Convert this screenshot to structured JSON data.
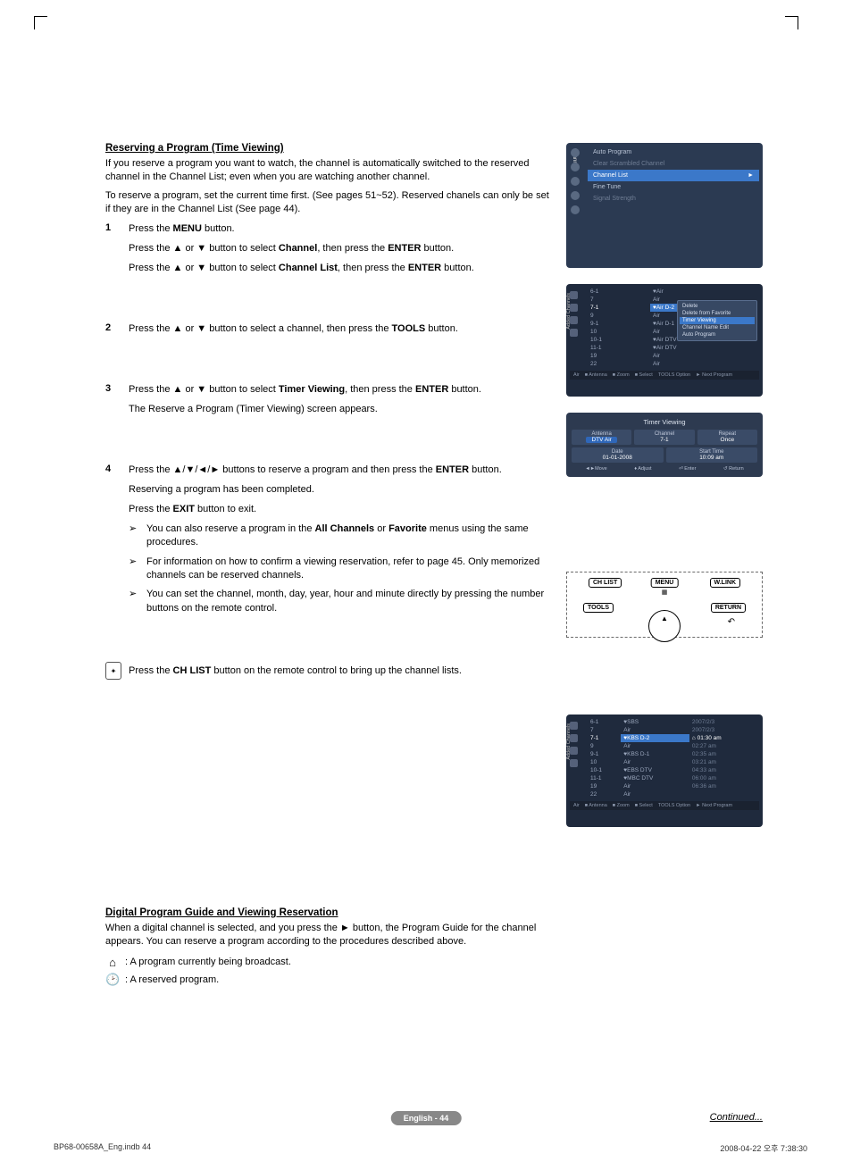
{
  "section1": {
    "title": "Reserving a Program (Time Viewing)",
    "intro1": "If you reserve a program you want to watch, the channel is automatically switched to the reserved channel in the Channel List; even when you are watching another channel.",
    "intro2": "To reserve a program, set the current time first. (See pages 51~52). Reserved chanels can only be set if they are in the Channel List (See page 44).",
    "steps": [
      {
        "n": "1",
        "lines": [
          {
            "pre": "Press the ",
            "b": "MENU",
            "post": " button."
          },
          {
            "pre": "Press the ▲ or ▼ button to select ",
            "b": "Channel",
            "post": ", then press the ",
            "b2": "ENTER",
            "post2": " button."
          },
          {
            "pre": "Press the ▲ or ▼ button to select ",
            "b": "Channel List",
            "post": ", then press the ",
            "b2": "ENTER",
            "post2": " button."
          }
        ]
      },
      {
        "n": "2",
        "lines": [
          {
            "pre": "Press the ▲ or ▼ button to select a channel, then press the ",
            "b": "TOOLS",
            "post": " button."
          }
        ]
      },
      {
        "n": "3",
        "lines": [
          {
            "pre": "Press the ▲ or ▼ button to select ",
            "b": "Timer Viewing",
            "post": ", then press the ",
            "b2": "ENTER",
            "post2": " button."
          },
          {
            "plain": "The Reserve a Program (Timer Viewing) screen appears."
          }
        ]
      },
      {
        "n": "4",
        "lines": [
          {
            "pre": "Press the ▲/▼/◄/► buttons to reserve a program and then press the ",
            "b": "ENTER",
            "post": " button."
          },
          {
            "plain": "Reserving a program has been completed."
          },
          {
            "pre": "Press the ",
            "b": "EXIT",
            "post": " button to exit."
          }
        ],
        "notes": [
          {
            "pre": "You can also reserve a program in the ",
            "b": "All Channels",
            "mid": " or ",
            "b2": "Favorite",
            "post": " menus using the same procedures."
          },
          {
            "plain": "For information on how to confirm a viewing reservation, refer to page 45. Only memorized channels can be reserved channels."
          },
          {
            "plain": "You can set the channel, month, day, year, hour and minute directly by pressing the number buttons on the remote control."
          }
        ]
      }
    ],
    "remote_tip": {
      "pre": "Press the ",
      "b": "CH LIST",
      "post": " button on the remote control to bring up the channel lists."
    }
  },
  "section2": {
    "title": "Digital Program Guide and Viewing Reservation",
    "intro": "When a digital channel is selected, and you press the ► button, the Program Guide for the channel appears. You can reserve a program according to the procedures described above.",
    "legend": [
      {
        "glyph": "⌂",
        "text": ": A program currently being broadcast."
      },
      {
        "glyph": "🕑",
        "text": ": A reserved program."
      }
    ]
  },
  "continued": "Continued...",
  "page_badge": "English - 44",
  "footer_left": "BP68-00658A_Eng.indb   44",
  "footer_right": "2008-04-22   오후 7:38:30",
  "panel_menu": {
    "vtab": "Channel",
    "items": [
      {
        "label": "Auto Program",
        "state": "normal"
      },
      {
        "label": "Clear Scrambled Channel",
        "state": "dim"
      },
      {
        "label": "Channel List",
        "state": "active",
        "arrow": "►"
      },
      {
        "label": "Fine Tune",
        "state": "normal"
      },
      {
        "label": "Signal Strength",
        "state": "dim"
      }
    ]
  },
  "panel_chlist": {
    "vtab": "Added Channels",
    "rows": [
      {
        "ch": "6-1",
        "name": "♥Air",
        "sel": false
      },
      {
        "ch": "7",
        "name": "Air",
        "sel": false
      },
      {
        "ch": "7-1",
        "name": "♥Air D-2",
        "sel": true
      },
      {
        "ch": "9",
        "name": "Air",
        "sel": false
      },
      {
        "ch": "9-1",
        "name": "♥Air D-1",
        "sel": false
      },
      {
        "ch": "10",
        "name": "Air",
        "sel": false
      },
      {
        "ch": "10-1",
        "name": "♥Air DTV",
        "sel": false
      },
      {
        "ch": "11-1",
        "name": "♥Air DTV",
        "sel": false
      },
      {
        "ch": "19",
        "name": "Air",
        "sel": false
      },
      {
        "ch": "22",
        "name": "Air",
        "sel": false
      }
    ],
    "popover": [
      "Delete",
      "Delete from Favorite",
      "Timer Viewing",
      "Channel Name Edit",
      "Auto Program"
    ],
    "popover_active": 2,
    "footer": [
      "Air",
      "■ Antenna",
      "■ Zoom",
      "■ Select",
      "TOOLS Option",
      "► Next Program"
    ]
  },
  "panel_timer": {
    "title": "Timer Viewing",
    "row1": [
      {
        "lab": "Antenna",
        "val": "DTV Air",
        "active": true
      },
      {
        "lab": "Channel",
        "val": "7-1",
        "active": false
      },
      {
        "lab": "Repeat",
        "val": "Once",
        "active": false
      }
    ],
    "row2": [
      {
        "lab": "Date",
        "val": "01-01-2008"
      },
      {
        "lab": "Start Time",
        "val": "10:09 am"
      }
    ],
    "bottom": [
      "◄►Move",
      "♦ Adjust",
      "⏎ Enter",
      "↺ Return"
    ]
  },
  "remote_buttons": {
    "chlist": "CH LIST",
    "menu": "MENU",
    "wlink": "W.LINK",
    "tools": "TOOLS",
    "return": "RETURN"
  },
  "panel_guide": {
    "vtab": "Added Channels",
    "rows": [
      {
        "ch": "6-1",
        "name": "♥SBS",
        "time": "2007/2/3"
      },
      {
        "ch": "7",
        "name": "Air",
        "time": "2007/2/3"
      },
      {
        "ch": "7-1",
        "name": "♥KBS D-2",
        "time": "⌂ 01:30   am",
        "sel": true
      },
      {
        "ch": "9",
        "name": "Air",
        "time": "02:27   am"
      },
      {
        "ch": "9-1",
        "name": "♥KBS D-1",
        "time": "02:35   am"
      },
      {
        "ch": "10",
        "name": "Air",
        "time": "03:21   am"
      },
      {
        "ch": "10-1",
        "name": "♥EBS DTV",
        "time": "04:33   am"
      },
      {
        "ch": "11-1",
        "name": "♥MBC DTV",
        "time": "06:00   am"
      },
      {
        "ch": "19",
        "name": "Air",
        "time": "06:36   am"
      },
      {
        "ch": "22",
        "name": "Air",
        "time": ""
      }
    ],
    "footer": [
      "Air",
      "■ Antenna",
      "■ Zoom",
      "■ Select",
      "TOOLS Option",
      "► Next Program"
    ]
  }
}
